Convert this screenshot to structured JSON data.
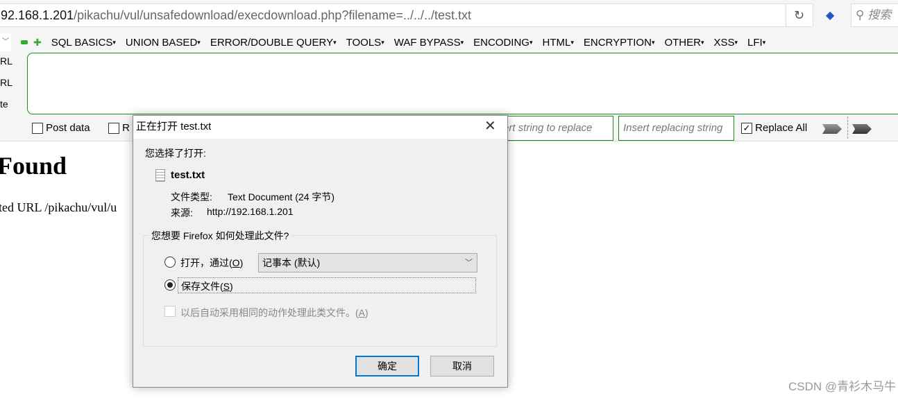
{
  "browser": {
    "url_host": "92.168.1.201",
    "url_path": "/pikachu/vul/unsafedownload/execdownload.php?filename=../../../test.txt",
    "search_placeholder": "搜索"
  },
  "hackbar": {
    "menu": [
      "SQL BASICS",
      "UNION BASED",
      "ERROR/DOUBLE QUERY",
      "TOOLS",
      "WAF BYPASS",
      "ENCODING",
      "HTML",
      "ENCRYPTION",
      "OTHER",
      "XSS",
      "LFI"
    ],
    "side_labels": [
      "RL",
      "RL",
      "te"
    ],
    "post_data": "Post data",
    "referrer": "R",
    "replace_placeholder": "Insert string to replace",
    "replacing_placeholder": "Insert replacing string",
    "replace_all": "Replace All",
    "replace_all_checked": true
  },
  "page": {
    "heading": "Found",
    "text": "ted URL /pikachu/vul/u"
  },
  "dialog": {
    "title": "正在打开 test.txt",
    "intro": "您选择了打开:",
    "filename": "test.txt",
    "type_label": "文件类型:",
    "type_value": "Text Document (24 字节)",
    "source_label": "来源:",
    "source_value": "http://192.168.1.201",
    "question": "您想要 Firefox 如何处理此文件?",
    "open_with_label": "打开，通过(",
    "open_with_key": "O",
    "open_with_app": "记事本 (默认)",
    "save_label": "保存文件(",
    "save_key": "S",
    "auto_label": "以后自动采用相同的动作处理此类文件。(",
    "auto_key": "A",
    "selected_option": "save",
    "ok": "确定",
    "cancel": "取消"
  },
  "watermark": "CSDN @青衫木马牛"
}
